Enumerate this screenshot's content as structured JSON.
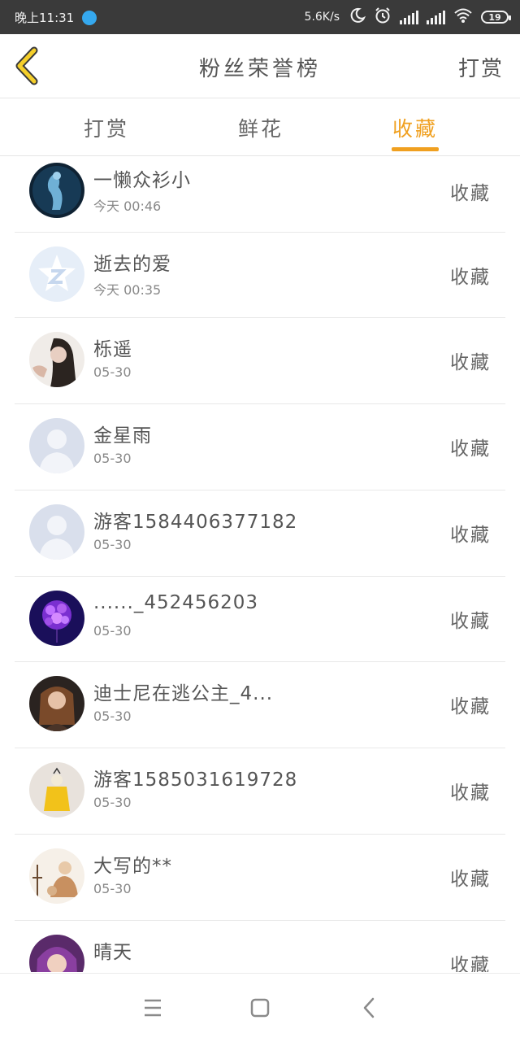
{
  "status_bar": {
    "time": "晚上11:31",
    "net_speed": "5.6K/s",
    "battery": "19",
    "icons": [
      "moon-icon",
      "alarm-icon",
      "signal-icon",
      "signal-icon",
      "wifi-icon",
      "battery-icon"
    ]
  },
  "header": {
    "title": "粉丝荣誉榜",
    "action": "打赏",
    "back_icon": "chevron-left-icon",
    "accent_color": "#f0a020"
  },
  "tabs": [
    {
      "label": "打赏",
      "active": false
    },
    {
      "label": "鲜花",
      "active": false
    },
    {
      "label": "收藏",
      "active": true
    }
  ],
  "list": [
    {
      "name": "一懒众衫小",
      "date": "今天 00:46",
      "action": "收藏",
      "avatar": "dark-blue-figure"
    },
    {
      "name": "逝去的爱",
      "date": "今天 00:35",
      "action": "收藏",
      "avatar": "qq-default"
    },
    {
      "name": "栎遥",
      "date": "05-30",
      "action": "收藏",
      "avatar": "girl-dark-hair"
    },
    {
      "name": "金星雨",
      "date": "05-30",
      "action": "收藏",
      "avatar": "default-person"
    },
    {
      "name": "游客1584406377182",
      "date": "05-30",
      "action": "收藏",
      "avatar": "default-person"
    },
    {
      "name": "......_452456203",
      "date": "05-30",
      "action": "收藏",
      "avatar": "purple-flowers"
    },
    {
      "name": "迪士尼在逃公主_4...",
      "date": "05-30",
      "action": "收藏",
      "avatar": "girl-brown-hair"
    },
    {
      "name": "游客1585031619728",
      "date": "05-30",
      "action": "收藏",
      "avatar": "yellow-doll"
    },
    {
      "name": "大写的**",
      "date": "05-30",
      "action": "收藏",
      "avatar": "anime-figure"
    },
    {
      "name": "晴天",
      "date": "",
      "action": "收藏",
      "avatar": "girl-purple-hair"
    }
  ],
  "nav": {
    "icons": [
      "menu-icon",
      "home-square-icon",
      "back-chevron-icon"
    ]
  }
}
